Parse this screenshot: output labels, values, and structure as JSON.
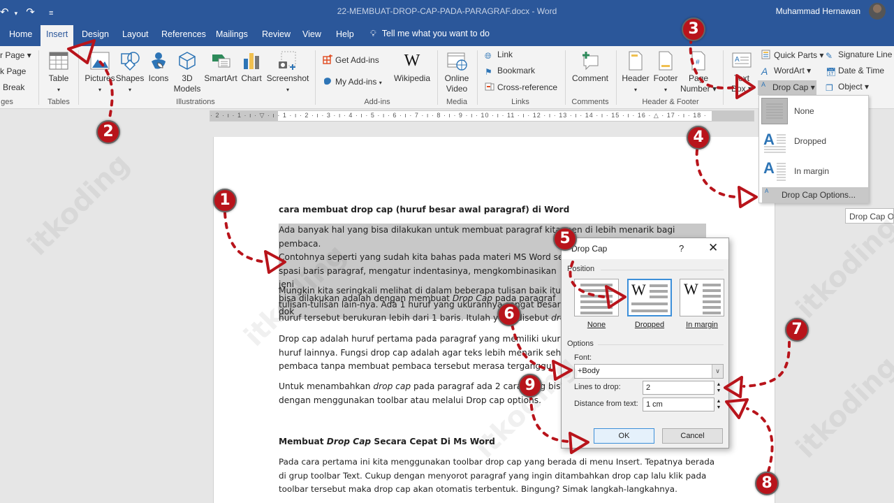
{
  "titlebar": {
    "document_title": "22-MEMBUAT-DROP-CAP-PADA-PARAGRAF.docx  -  Word",
    "user_name": "Muhammad Hernawan",
    "undo_icon": "undo-icon",
    "redo_icon": "redo-icon",
    "customize_icon": "customize-qat-icon"
  },
  "tabs": [
    {
      "label": "Home"
    },
    {
      "label": "Insert",
      "active": true
    },
    {
      "label": "Design"
    },
    {
      "label": "Layout"
    },
    {
      "label": "References"
    },
    {
      "label": "Mailings"
    },
    {
      "label": "Review"
    },
    {
      "label": "View"
    },
    {
      "label": "Help"
    }
  ],
  "tell_me": "Tell me what you want to do",
  "ribbon": {
    "pages_group": {
      "items": [
        "r Page ▾",
        "k Page",
        "Break"
      ],
      "label": "ges"
    },
    "tables_group": {
      "table": "Table",
      "label": "Tables"
    },
    "illustrations_group": {
      "pictures": "Pictures",
      "shapes": "Shapes",
      "icons": "Icons",
      "models_3d": "3D Models",
      "models_line1": "3D",
      "models_line2": "Models",
      "smartart": "SmartArt",
      "chart": "Chart",
      "screenshot": "Screenshot",
      "label": "Illustrations"
    },
    "addins_group": {
      "get_addins": "Get Add-ins",
      "my_addins": "My Add-ins",
      "wikipedia": "Wikipedia",
      "label": "Add-ins"
    },
    "media_group": {
      "line1": "Online",
      "line2": "Video",
      "label": "Media"
    },
    "links_group": {
      "link": "Link",
      "bookmark": "Bookmark",
      "cross_reference": "Cross-reference",
      "label": "Links"
    },
    "comments_group": {
      "comment": "Comment",
      "label": "Comments"
    },
    "header_footer_group": {
      "header": "Header",
      "footer": "Footer",
      "page_line1": "Page",
      "page_line2": "Number ▾",
      "label": "Header & Footer"
    },
    "text_group": {
      "text_box_line1": "Text",
      "text_box_line2": "Box ▾",
      "quick_parts": "Quick Parts ▾",
      "wordart": "WordArt ▾",
      "drop_cap": "Drop Cap ▾",
      "signature_line": "Signature Line",
      "date_time": "Date & Time",
      "object": "Object  ▾"
    }
  },
  "ruler": {
    "ticks": "· 2 · ı · 1 · ı · ▽ · ı · 1 · ı · 2 · ı · 3 · ı · 4 · ı · 5 · ı · 6 · ı · 7 · ı · 8 · ı · 9 · ı · 10 · ı · 11 · ı · 12 · ı · 13 · ı · 14 · ı · 15 · ı · 16 · △ · 17 · ı · 18 ·"
  },
  "document": {
    "heading1": "cara membuat drop cap (huruf besar awal paragraf) di Word",
    "para1": [
      "Ada banyak hal yang bisa dilakukan untuk membuat paragraf kita men di lebih menarik bagi pembaca.",
      "Contohnya seperti yang sudah kita bahas pada materi MS Word seb",
      "spasi baris paragraf, mengatur indentasinya, mengkombinasikan jeni",
      "bisa dilakukan adalah dengan membuat ",
      "Drop Cap",
      " pada paragraf dok"
    ],
    "para2": [
      "Mungkin kita seringkali melihat di dalam beberapa tulisan baik itu di",
      "tulisan-tulisan lain-nya. Ada 1 huruf yang ukurannya sangat besar di a",
      "huruf tersebut berukuran lebih dari 1 baris. Itulah yang disebut ",
      "drop"
    ],
    "para3": [
      "Drop cap adalah huruf pertama pada paragraf yang memiliki ukuran",
      "huruf lainnya. Fungsi drop cap adalah agar teks lebih menarik sehing",
      "pembaca tanpa membuat pembaca tersebut merasa terganggu."
    ],
    "para4": [
      "Untuk menambahkan ",
      "drop cap",
      " pada paragraf ada 2 cara yang bisa di",
      "dengan menggunakan toolbar atau melalui Drop cap options."
    ],
    "heading2": [
      "Membuat ",
      "Drop Cap",
      " Secara Cepat Di Ms Word"
    ],
    "para5": [
      "Pada cara pertama ini kita menggunakan toolbar drop cap yang berada di menu Insert. Tepatnya berada",
      "di grup toolbar Text. Cukup dengan menyorot paragraf yang ingin ditambahkan drop cap lalu klik pada",
      "toolbar tersebut maka drop cap akan otomatis terbentuk. Bingung? Simak langkah-langkahnya."
    ]
  },
  "dropcap_menu": {
    "items": [
      {
        "label": "None",
        "icon": "dropcap-none-icon"
      },
      {
        "label": "Dropped",
        "icon": "dropcap-dropped-icon"
      },
      {
        "label": "In margin",
        "icon": "dropcap-in-margin-icon"
      }
    ],
    "options": "Drop Cap Options...",
    "tooltip": "Drop Cap Options"
  },
  "dialog": {
    "title": "Drop Cap",
    "help": "?",
    "close": "✕",
    "position_label": "Position",
    "positions": [
      {
        "label": "None",
        "selected": false
      },
      {
        "label": "Dropped",
        "selected": true
      },
      {
        "label": "In margin",
        "selected": false
      }
    ],
    "options_label": "Options",
    "font_label": "Font:",
    "font_value": "+Body",
    "lines_label": "Lines to drop:",
    "lines_value": "2",
    "distance_label": "Distance from text:",
    "distance_value": "1 cm",
    "ok": "OK",
    "cancel": "Cancel"
  },
  "annotations": {
    "steps": [
      "1",
      "2",
      "3",
      "4",
      "5",
      "6",
      "7",
      "8",
      "9"
    ],
    "color": "#b8141b"
  },
  "watermark": "itkoding",
  "colors": {
    "word_blue": "#2b579a",
    "ribbon_bg": "#f3f3f3",
    "selection": "#c8c8c8",
    "dialog_focus": "#3c8fd9"
  }
}
